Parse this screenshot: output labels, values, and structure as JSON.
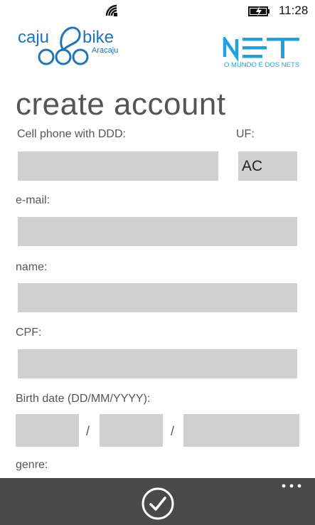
{
  "status_bar": {
    "time": "11:28",
    "signal_icon": "wifi-signal-icon",
    "battery_icon": "battery-charging-icon"
  },
  "logos": {
    "caju": {
      "word1": "caju",
      "word2": "bike",
      "city": "Aracaju",
      "color": "#1b75bb"
    },
    "net": {
      "text": "NET",
      "tagline": "O MUNDO É DOS NETS",
      "color": "#1ea3e0"
    }
  },
  "page": {
    "title": "create account"
  },
  "form": {
    "cell_phone_label": "Cell phone with DDD:",
    "cell_phone_value": "",
    "uf_label": "UF:",
    "uf_value": "AC",
    "email_label": "e-mail:",
    "email_value": "",
    "name_label": "name:",
    "name_value": "",
    "cpf_label": "CPF:",
    "cpf_value": "",
    "birth_label": "Birth date (DD/MM/YYYY):",
    "birth_day": "",
    "birth_month": "",
    "birth_year": "",
    "separator": "/",
    "next_label_partial": "genre:"
  },
  "app_bar": {
    "confirm_icon": "check-circle-icon",
    "more_icon": "ellipsis-icon",
    "background": "#4a4a4a"
  }
}
